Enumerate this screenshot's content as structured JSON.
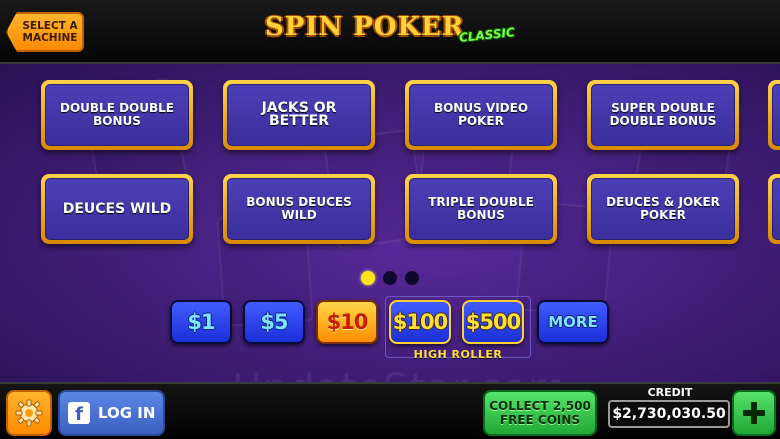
{
  "header": {
    "back_label_line1": "SELECT A",
    "back_label_line2": "MACHINE",
    "logo_main": "SPIN POKER",
    "logo_sub": "CLASSIC"
  },
  "games": [
    {
      "label": "DOUBLE DOUBLE BONUS"
    },
    {
      "label": "JACKS OR BETTER"
    },
    {
      "label": "BONUS VIDEO POKER"
    },
    {
      "label": "SUPER DOUBLE DOUBLE BONUS"
    },
    {
      "label": "DEUCES WILD"
    },
    {
      "label": "BONUS DEUCES WILD"
    },
    {
      "label": "TRIPLE DOUBLE BONUS"
    },
    {
      "label": "DEUCES & JOKER POKER"
    }
  ],
  "pagination": {
    "pages": 3,
    "current": 1
  },
  "denominations": [
    {
      "label": "$1",
      "selected": false
    },
    {
      "label": "$5",
      "selected": false
    },
    {
      "label": "$10",
      "selected": true
    },
    {
      "label": "$100",
      "selected": false,
      "high_roller": true
    },
    {
      "label": "$500",
      "selected": false,
      "high_roller": true
    },
    {
      "label": "MORE",
      "selected": false
    }
  ],
  "high_roller_label": "HIGH ROLLER",
  "footer": {
    "settings_icon": "gear-icon",
    "fb_icon_letter": "f",
    "login_label": "LOG IN",
    "collect_line1": "COLLECT 2,500",
    "collect_line2": "FREE COINS",
    "credit_label": "CREDIT",
    "credit_value": "$2,730,030.50",
    "plus_symbol": "+"
  },
  "watermark": "UpdateStar.com",
  "colors": {
    "accent_orange": "#ff8a00",
    "tile_gold": "#ffd34a",
    "tile_blue": "#3b2f9c",
    "background_purple": "#44207d",
    "green_button": "#1fa836"
  }
}
